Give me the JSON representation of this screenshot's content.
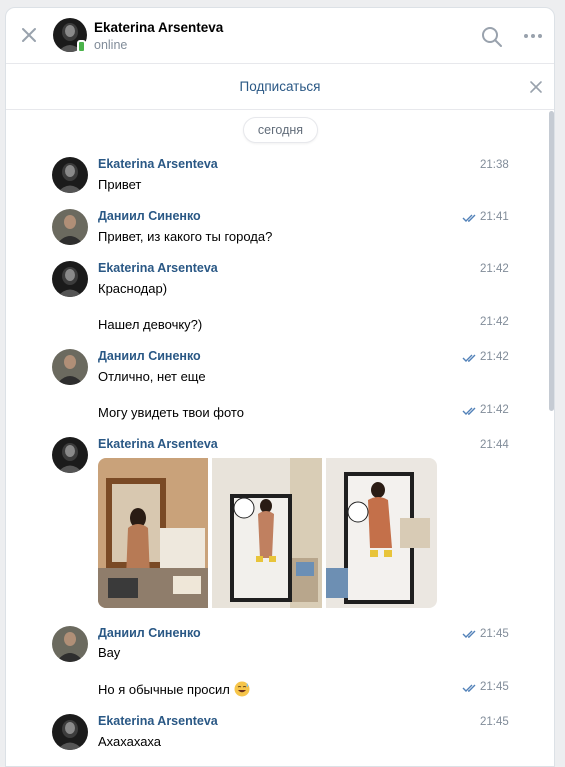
{
  "header": {
    "close_icon": "close-icon",
    "name": "Ekaterina Arsenteva",
    "status": "online",
    "search_icon": "search-icon",
    "more_icon": "more-icon"
  },
  "subscribe": {
    "label": "Подписаться",
    "close_icon": "close-icon"
  },
  "date_chip": "сегодня",
  "messages": [
    {
      "sender": "Ekaterina Arsenteva",
      "text": "Привет",
      "time": "21:38"
    },
    {
      "sender": "Даниил Синенко",
      "text": "Привет, из какого ты города?",
      "time": "21:41"
    },
    {
      "sender": "Ekaterina Arsenteva",
      "text": "Краснодар)",
      "time": "21:42"
    },
    {
      "sender": "",
      "text": "Нашел девочку?)",
      "time": "21:42"
    },
    {
      "sender": "Даниил Синенко",
      "text": "Отлично, нет еще",
      "time": "21:42"
    },
    {
      "sender": "",
      "text": "Могу увидеть твои фото",
      "time": "21:42"
    },
    {
      "sender": "Ekaterina Arsenteva",
      "text": "",
      "time": "21:44"
    },
    {
      "sender": "Даниил Синенко",
      "text": "Вау",
      "time": "21:45"
    },
    {
      "sender": "",
      "text": "Но я обычные просил",
      "time": "21:45"
    },
    {
      "sender": "Ekaterina Arsenteva",
      "text": "Ахахахаха",
      "time": "21:45"
    }
  ],
  "colors": {
    "accent": "#2a5885",
    "online": "#4bb34b",
    "read_check": "#5181b8",
    "muted": "#818c99"
  }
}
